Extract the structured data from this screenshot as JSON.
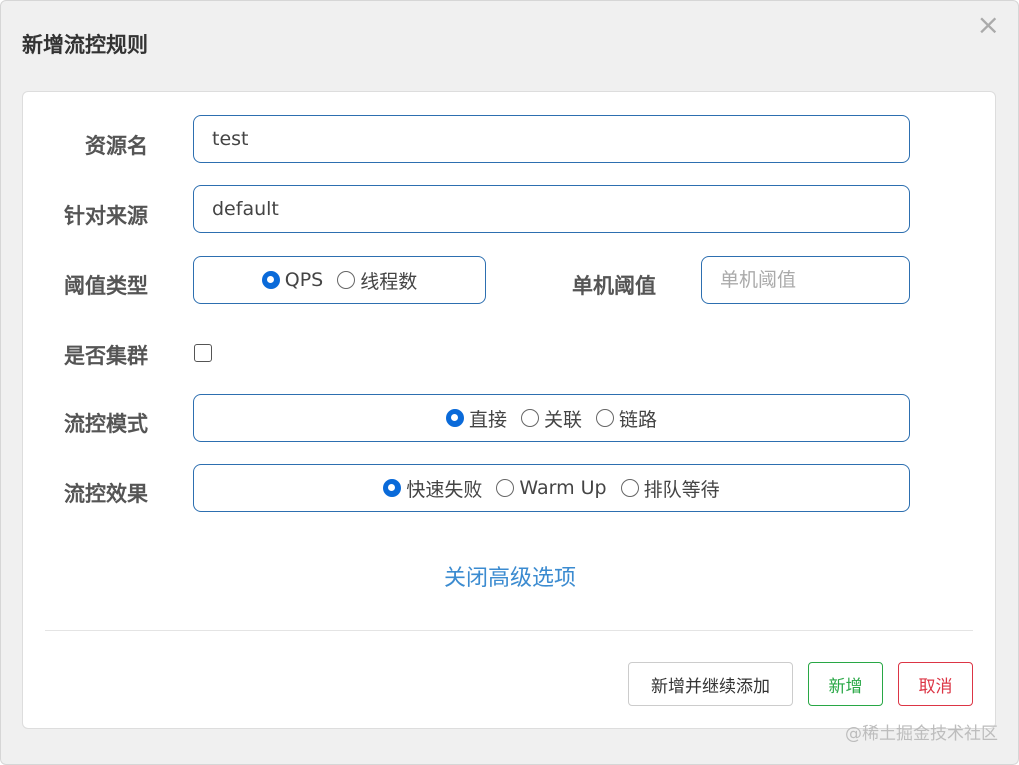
{
  "dialog": {
    "title": "新增流控规则",
    "close_symbol": "×"
  },
  "form": {
    "resource_name": {
      "label": "资源名",
      "value": "test"
    },
    "limit_app": {
      "label": "针对来源",
      "value": "default"
    },
    "grade": {
      "label": "阈值类型",
      "options": [
        {
          "label": "QPS",
          "checked": true
        },
        {
          "label": "线程数",
          "checked": false
        }
      ]
    },
    "count": {
      "label": "单机阈值",
      "placeholder": "单机阈值",
      "value": ""
    },
    "cluster_mode": {
      "label": "是否集群",
      "checked": false
    },
    "strategy": {
      "label": "流控模式",
      "options": [
        {
          "label": "直接",
          "checked": true
        },
        {
          "label": "关联",
          "checked": false
        },
        {
          "label": "链路",
          "checked": false
        }
      ]
    },
    "control_behavior": {
      "label": "流控效果",
      "options": [
        {
          "label": "快速失败",
          "checked": true
        },
        {
          "label": "Warm Up",
          "checked": false
        },
        {
          "label": "排队等待",
          "checked": false
        }
      ]
    },
    "advanced_toggle": "关闭高级选项"
  },
  "footer": {
    "add_and_continue": "新增并继续添加",
    "add": "新增",
    "cancel": "取消"
  },
  "watermark": "@稀土掘金技术社区"
}
